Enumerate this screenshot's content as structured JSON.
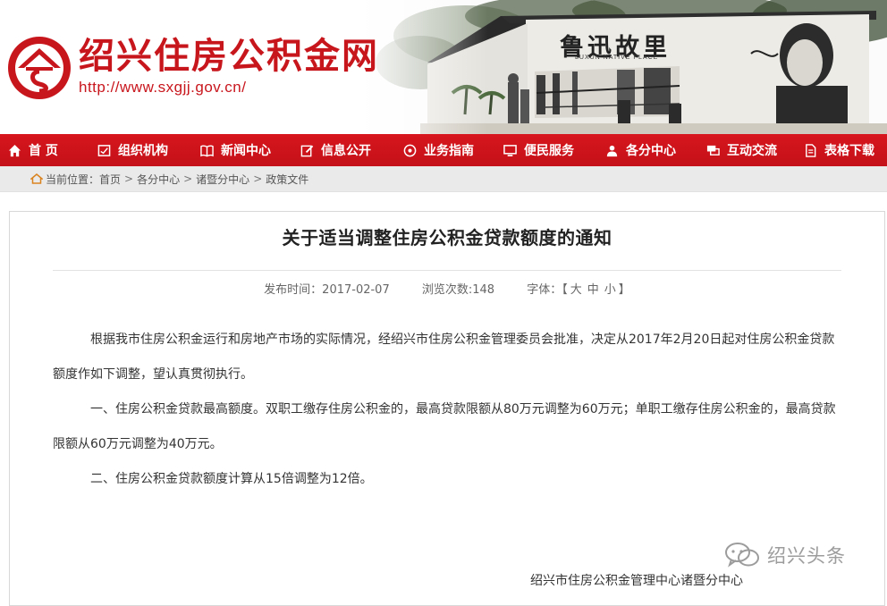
{
  "header": {
    "site_title": "绍兴住房公积金网",
    "site_url": "http://www.sxgjj.gov.cn/",
    "banner_wall_title": "鲁迅故里",
    "banner_wall_subtitle": "LUXUN NATIVE PLACE",
    "brand_color": "#c8161d"
  },
  "nav": {
    "items": [
      {
        "label": "首 页",
        "icon": "home-icon"
      },
      {
        "label": "组织机构",
        "icon": "org-icon"
      },
      {
        "label": "新闻中心",
        "icon": "book-icon"
      },
      {
        "label": "信息公开",
        "icon": "edit-icon"
      },
      {
        "label": "业务指南",
        "icon": "compass-icon"
      },
      {
        "label": "便民服务",
        "icon": "monitor-icon"
      },
      {
        "label": "各分中心",
        "icon": "branch-icon"
      },
      {
        "label": "互动交流",
        "icon": "chat-icon"
      },
      {
        "label": "表格下载",
        "icon": "file-icon"
      }
    ]
  },
  "breadcrumb": {
    "prefix": "当前位置：",
    "items": [
      "首页",
      "各分中心",
      "诸暨分中心",
      "政策文件"
    ],
    "separator": ">"
  },
  "article": {
    "title": "关于适当调整住房公积金贷款额度的通知",
    "publish_label": "发布时间：2017-02-07",
    "views_label": "浏览次数:148",
    "font_size_label": "字体：",
    "font_size_open": "【",
    "font_size_options": [
      "大",
      "中",
      "小"
    ],
    "font_size_close": "】",
    "paragraphs": [
      "根据我市住房公积金运行和房地产市场的实际情况，经绍兴市住房公积金管理委员会批准，决定从2017年2月20日起对住房公积金贷款额度作如下调整，望认真贯彻执行。",
      "一、住房公积金贷款最高额度。双职工缴存住房公积金的，最高贷款限额从80万元调整为60万元；单职工缴存住房公积金的，最高贷款限额从60万元调整为40万元。",
      "二、住房公积金贷款额度计算从15倍调整为12倍。"
    ],
    "signature": "绍兴市住房公积金管理中心诸暨分中心"
  },
  "watermark": {
    "text": "绍兴头条"
  }
}
